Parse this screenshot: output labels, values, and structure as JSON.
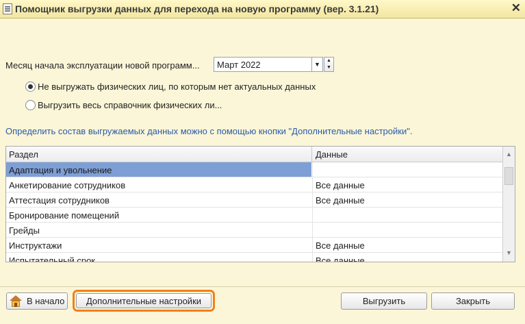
{
  "window": {
    "title": "Помощник выгрузки данных для перехода на новую программу (вер. 3.1.21)",
    "close_glyph": "✕"
  },
  "month": {
    "label": "Месяц начала эксплуатации новой программ...",
    "value": "Март 2022"
  },
  "options": {
    "items": [
      {
        "label": "Не выгружать физических лиц, по которым нет актуальных данных",
        "selected": true
      },
      {
        "label": "Выгрузить весь справочник физических ли...",
        "selected": false
      }
    ]
  },
  "hint": "Определить состав выгружаемых данных можно с помощью кнопки \"Дополнительные настройки\".",
  "table": {
    "columns": [
      "Раздел",
      "Данные"
    ],
    "rows": [
      {
        "section": "Адаптация и увольнение",
        "data": "",
        "selected": true
      },
      {
        "section": "Анкетирование сотрудников",
        "data": "Все данные"
      },
      {
        "section": "Аттестация сотрудников",
        "data": "Все данные"
      },
      {
        "section": "Бронирование помещений",
        "data": ""
      },
      {
        "section": "Грейды",
        "data": ""
      },
      {
        "section": "Инструктажи",
        "data": "Все данные"
      },
      {
        "section": "Испытательный срок",
        "data": "Все данные"
      }
    ]
  },
  "buttons": {
    "home": "В начало",
    "extra_settings": "Дополнительные настройки",
    "export": "Выгрузить",
    "close": "Закрыть"
  },
  "colors": {
    "background": "#fbf6d8",
    "selection": "#7e9fd6",
    "hint": "#2b5aa8",
    "highlight": "#f0801c"
  },
  "icons": [
    "document-icon",
    "close-icon",
    "dropdown-arrow-icon",
    "spin-icon",
    "radio-icon",
    "scroll-up-icon",
    "scroll-down-icon",
    "home-icon"
  ]
}
